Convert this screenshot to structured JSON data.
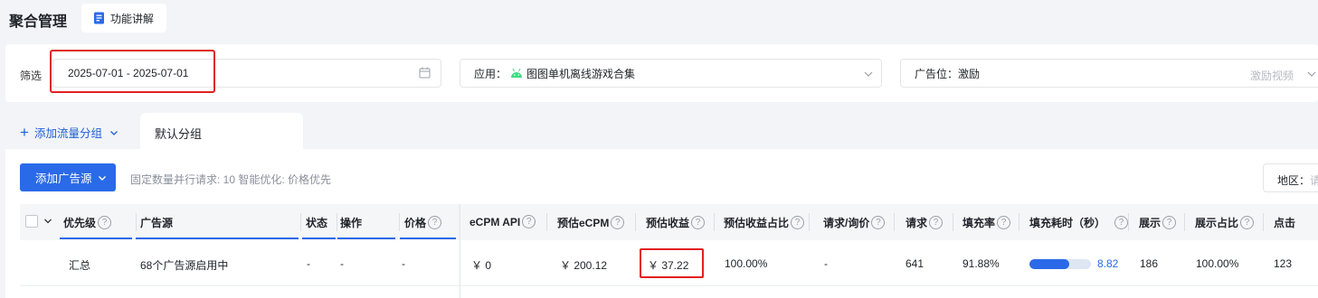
{
  "header": {
    "title": "聚合管理",
    "help_label": "功能讲解"
  },
  "filter": {
    "label": "筛选",
    "date_range": "2025-07-01 - 2025-07-01",
    "app_prefix": "应用：",
    "app_name": "图图单机离线游戏合集",
    "slot_prefix": "广告位：",
    "slot_value": "激励",
    "slot_placeholder": "激励视频"
  },
  "groups": {
    "add_label": "添加流量分组",
    "tabs": [
      {
        "label": "默认分组"
      }
    ]
  },
  "toolbar": {
    "add_source_label": "添加广告源",
    "hint": "固定数量并行请求: 10   智能优化: 价格优先",
    "region_label": "地区：",
    "region_placeholder": "请"
  },
  "table": {
    "columns": [
      "优先级",
      "广告源",
      "状态",
      "操作",
      "价格",
      "eCPM API",
      "预估eCPM",
      "预估收益",
      "预估收益占比",
      "请求/询价",
      "请求",
      "填充率",
      "填充耗时（秒）",
      "展示",
      "展示占比",
      "点击"
    ],
    "summary_row": {
      "priority": "汇总",
      "source": "68个广告源启用中",
      "status": "-",
      "action": "-",
      "price": "-",
      "ecpm_api": "￥ 0",
      "est_ecpm": "￥ 200.12",
      "est_revenue": "￥ 37.22",
      "revenue_share": "100.00%",
      "req_bid": "-",
      "requests": "641",
      "fill_rate": "91.88%",
      "fill_time": "8.82",
      "fill_time_bar_fraction": 0.65,
      "impressions": "186",
      "impression_share": "100.00%",
      "clicks": "123"
    }
  },
  "colors": {
    "accent": "#2a6ae8",
    "highlight": "#e0201f",
    "android": "#3ddc84"
  }
}
